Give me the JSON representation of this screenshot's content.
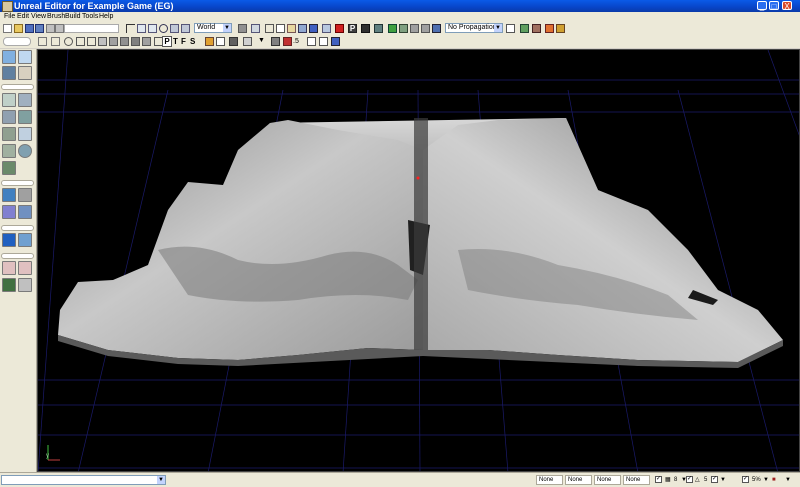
{
  "window": {
    "title": "Unreal Editor for Example Game (EG)",
    "minimize": "_",
    "maximize": "□",
    "close": "X"
  },
  "menu": [
    "File",
    "Edit",
    "View",
    "Brush",
    "Build",
    "Tools",
    "Help"
  ],
  "toolbar": {
    "coordinate_system": "World",
    "propagation": "No Propagation",
    "view_mode_letters": [
      "P",
      "T",
      "F",
      "S"
    ],
    "p_button_label": "P",
    "snap_value": ".5"
  },
  "viewport": {
    "axis_label": "y"
  },
  "statusbar": {
    "fields": [
      "None",
      "None",
      "None",
      "None"
    ],
    "grid_snap": "8",
    "rotation_snap": "5",
    "scale_snap": "5%",
    "check": "✓"
  },
  "colors": {
    "titlebar": "#0a5ae8",
    "viewport_bg": "#000000",
    "grid": "#1a1a6a",
    "terrain": "#b5b5b5"
  }
}
